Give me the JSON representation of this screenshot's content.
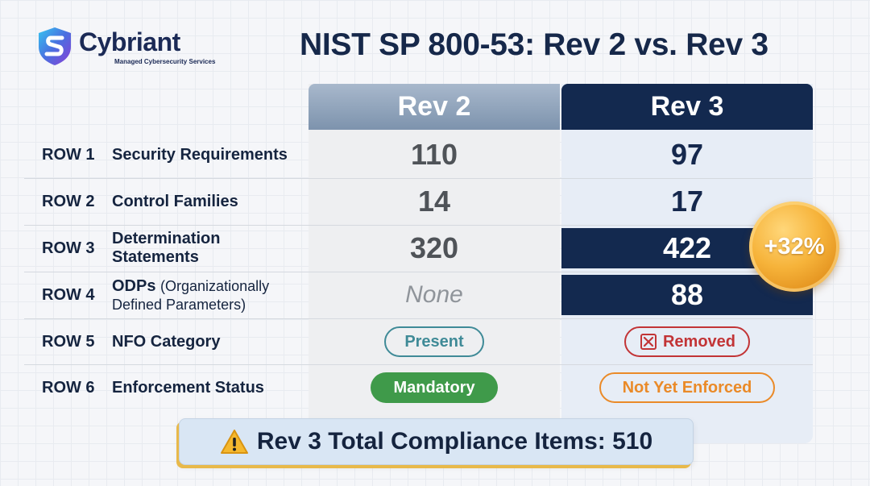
{
  "brand": {
    "name": "Cybriant",
    "tagline": "Managed Cybersecurity Services",
    "logo_icon": "shield-s-logo-icon"
  },
  "title": "NIST SP 800-53: Rev 2 vs. Rev 3",
  "columns": {
    "rev2": "Rev 2",
    "rev3": "Rev 3"
  },
  "rows": [
    {
      "num": "ROW 1",
      "label": "Security Requirements",
      "rev2": "110",
      "rev3": "97"
    },
    {
      "num": "ROW 2",
      "label": "Control Families",
      "rev2": "14",
      "rev3": "17"
    },
    {
      "num": "ROW 3",
      "label_line1": "Determination",
      "label_line2": "Statements",
      "rev2": "320",
      "rev3": "422"
    },
    {
      "num": "ROW 4",
      "label_bold": "ODPs",
      "label_light": "(Organizationally",
      "label_line2": "Defined Parameters)",
      "rev2": "None",
      "rev3": "88"
    },
    {
      "num": "ROW 5",
      "label": "NFO Category",
      "rev2": "Present",
      "rev3": "Removed",
      "rev3_icon": "removed-x-icon"
    },
    {
      "num": "ROW 6",
      "label": "Enforcement Status",
      "rev2": "Mandatory",
      "rev3": "Not Yet Enforced"
    }
  ],
  "badge": "+32%",
  "footer": {
    "text": "Rev 3 Total Compliance Items: 510",
    "icon": "warning-icon"
  },
  "colors": {
    "navy": "#13294f",
    "rev2_header": "#7d93ad",
    "present": "#3f8a97",
    "removed": "#c23436",
    "mandatory": "#3f9a4a",
    "not_enforced": "#ea8a28",
    "badge": "#f6b33a"
  }
}
